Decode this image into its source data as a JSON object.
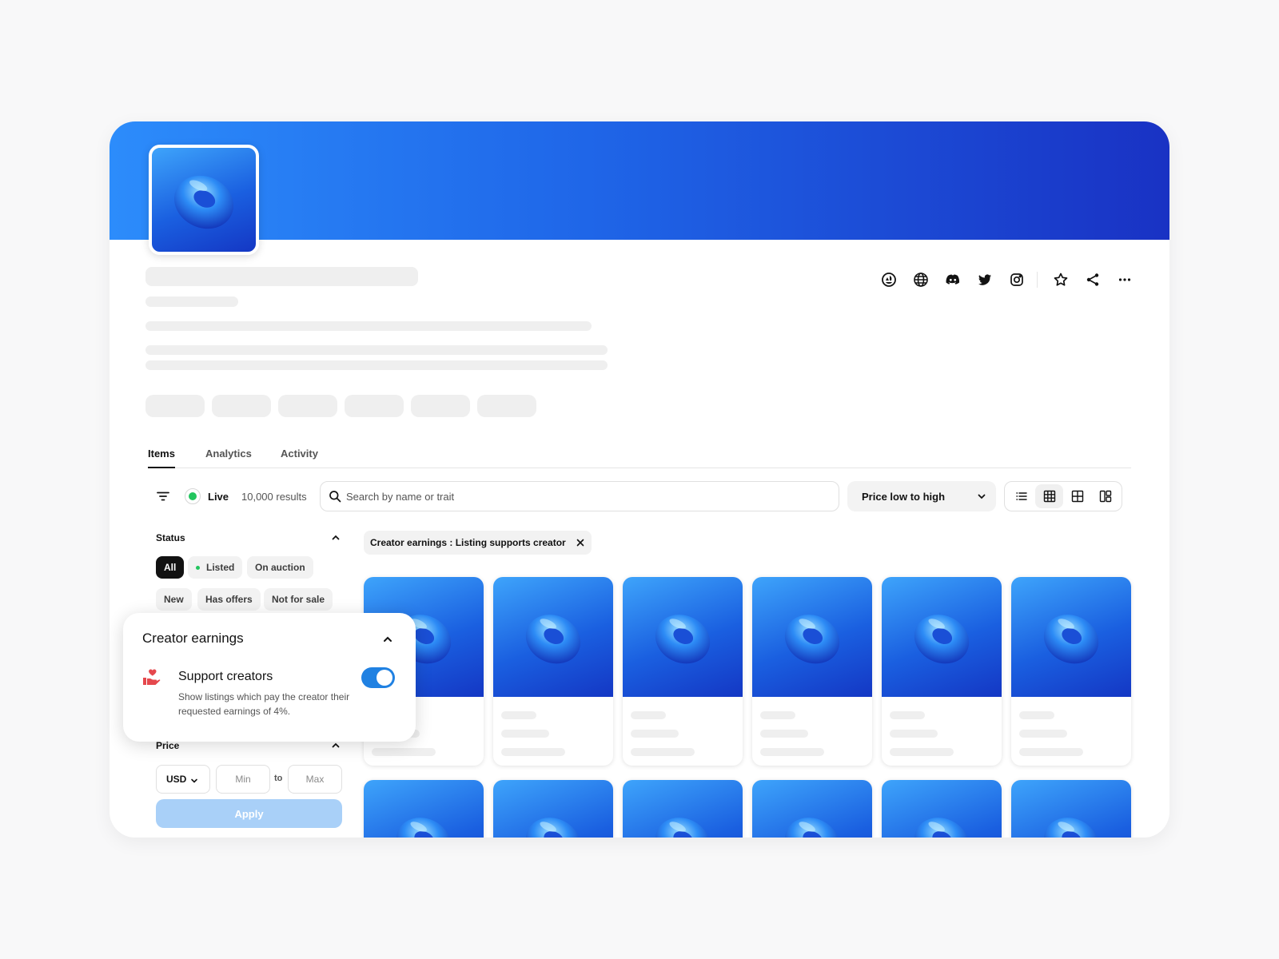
{
  "colors": {
    "accent": "#2081e2",
    "banner_start": "#2c8cfb",
    "banner_end": "#1932c4",
    "live": "#22c55e",
    "apply_disabled": "#a9d0f8"
  },
  "social_icons": [
    "opensea-icon",
    "globe-icon",
    "discord-icon",
    "twitter-icon",
    "instagram-icon",
    "star-icon",
    "share-icon",
    "more-icon"
  ],
  "tabs": [
    {
      "label": "Items",
      "active": true
    },
    {
      "label": "Analytics",
      "active": false
    },
    {
      "label": "Activity",
      "active": false
    }
  ],
  "toolbar": {
    "live_label": "Live",
    "results": "10,000 results",
    "search_placeholder": "Search by name or trait",
    "sort_label": "Price low to high",
    "view_modes": [
      "list-view-icon",
      "grid-small-icon",
      "grid-large-icon",
      "mosaic-icon"
    ],
    "active_view": "grid-small-icon"
  },
  "sidebar": {
    "status_title": "Status",
    "status_chips": [
      "All",
      "Listed",
      "On auction",
      "New",
      "Has offers",
      "Not for sale"
    ],
    "selected_status": "All",
    "price_title": "Price",
    "currency": "USD",
    "min_placeholder": "Min",
    "max_placeholder": "Max",
    "to_label": "to",
    "apply_label": "Apply"
  },
  "applied_filter": "Creator earnings : Listing supports creator",
  "popup": {
    "title": "Creator earnings",
    "option_label": "Support creators",
    "option_description": "Show listings which pay the creator their requested earnings of 4%.",
    "toggle_on": true
  }
}
